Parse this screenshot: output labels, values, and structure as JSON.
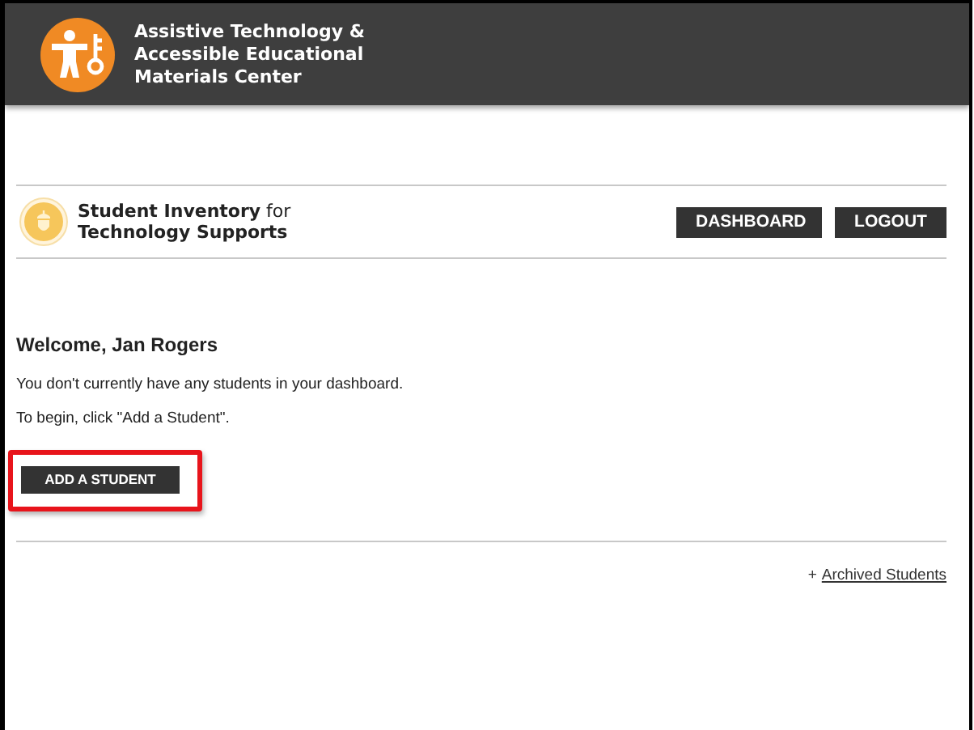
{
  "header": {
    "title_lines": [
      "Assistive Technology &",
      "Accessible Educational",
      "Materials Center"
    ]
  },
  "app": {
    "title": "**Student Inventory** for",
    "subtitle": "Technology Supports"
  },
  "nav_buttons": [
    "DASHBOARD",
    "LOGOUT"
  ],
  "welcome": {
    "heading": "Welcome, Jan Rogers",
    "messages": [
      "You don't currently have any students in your dashboard.",
      "To begin, click \"Add a Student\"."
    ]
  },
  "add_button": {
    "label": "ADD A STUDENT",
    "highlighted": true
  },
  "archived_link": {
    "prefix": "+",
    "label": "Archived Students"
  }
}
